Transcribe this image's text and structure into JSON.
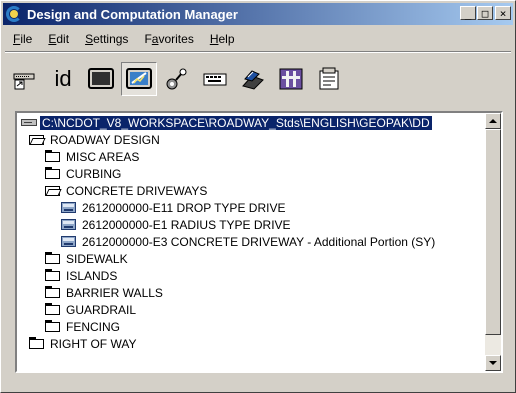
{
  "window": {
    "title": "Design and Computation Manager",
    "controls": {
      "minimize": "_",
      "maximize": "□",
      "close": "×"
    }
  },
  "menu": [
    {
      "label": "File",
      "u": "F",
      "rest": "ile"
    },
    {
      "label": "Edit",
      "u": "E",
      "rest": "dit"
    },
    {
      "label": "Settings",
      "u": "S",
      "rest": "ettings"
    },
    {
      "label": "Favorites",
      "pre": "F",
      "u": "a",
      "rest": "vorites"
    },
    {
      "label": "Help",
      "u": "H",
      "rest": "elp"
    }
  ],
  "toolbar": {
    "id_label": "id",
    "tools": [
      "keyin-icon",
      "id-icon",
      "display-icon",
      "design-icon",
      "dialog-icon",
      "keyboard-icon",
      "build-icon",
      "place-icon",
      "properties-icon"
    ],
    "active_tool": "design-icon"
  },
  "tree": {
    "root": "C:\\NCDOT_V8_WORKSPACE\\ROADWAY_Stds\\ENGLISH\\GEOPAK\\DD",
    "nodes": [
      {
        "label": "ROADWAY DESIGN",
        "icon": "folder-open-icon",
        "level": 1
      },
      {
        "label": "MISC AREAS",
        "icon": "folder-icon",
        "level": 2
      },
      {
        "label": "CURBING",
        "icon": "folder-icon",
        "level": 2
      },
      {
        "label": "CONCRETE DRIVEWAYS",
        "icon": "folder-open-icon",
        "level": 2
      },
      {
        "label": "2612000000-E11 DROP TYPE DRIVE",
        "icon": "item-icon",
        "level": 3
      },
      {
        "label": "2612000000-E1 RADIUS TYPE DRIVE",
        "icon": "item-icon",
        "level": 3
      },
      {
        "label": "2612000000-E3 CONCRETE DRIVEWAY - Additional Portion (SY)",
        "icon": "item-icon",
        "level": 3
      },
      {
        "label": "SIDEWALK",
        "icon": "folder-icon",
        "level": 2
      },
      {
        "label": "ISLANDS",
        "icon": "folder-icon",
        "level": 2
      },
      {
        "label": "BARRIER WALLS",
        "icon": "folder-icon",
        "level": 2
      },
      {
        "label": "GUARDRAIL",
        "icon": "folder-icon",
        "level": 2
      },
      {
        "label": "FENCING",
        "icon": "folder-icon",
        "level": 2
      },
      {
        "label": "RIGHT OF WAY",
        "icon": "folder-icon",
        "level": 1
      }
    ]
  }
}
